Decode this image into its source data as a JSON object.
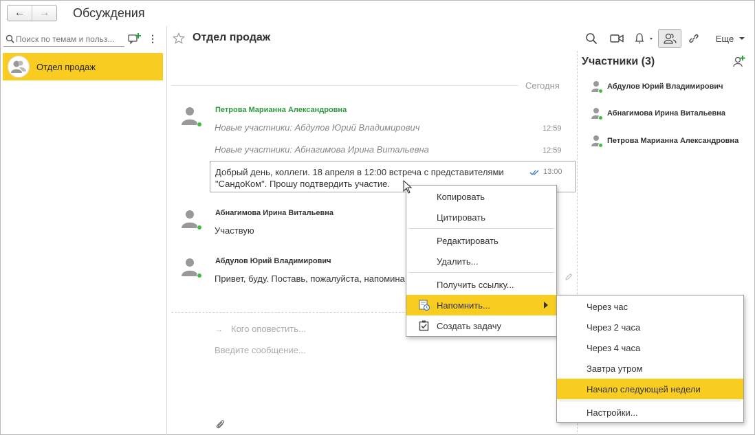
{
  "app": {
    "title": "Обсуждения"
  },
  "left": {
    "search_placeholder": "Поиск по темам и польз...",
    "conversations": [
      {
        "label": "Отдел продаж"
      }
    ]
  },
  "chat": {
    "title": "Отдел продаж",
    "more_label": "Еще",
    "today": "Сегодня",
    "messages": {
      "author1": "Петрова Марианна Александровна",
      "sys1": "Новые участники: Абдулов Юрий Владимирович",
      "sys1_time": "12:59",
      "sys2": "Новые участники: Абнагимова Ирина Витальевна",
      "sys2_time": "12:59",
      "main_text_line1": "Добрый день, коллеги. 18 апреля в 12:00 встреча с представителями",
      "main_text_line2": "\"СандоКом\". Прошу подтвердить участие.",
      "main_time": "13:00",
      "author2": "Абнагимова Ирина Витальевна",
      "text2": "Участвую",
      "author3": "Абдулов Юрий Владимирович",
      "text3": "Привет, буду. Поставь, пожалуйста, напомина"
    },
    "notify_placeholder": "Кого оповестить...",
    "compose_placeholder": "Введите сообщение..."
  },
  "participants": {
    "title": "Участники (3)",
    "items": [
      {
        "name": "Абдулов Юрий Владимирович"
      },
      {
        "name": "Абнагимова Ирина Витальевна"
      },
      {
        "name": "Петрова Марианна Александровна"
      }
    ]
  },
  "context_menu": {
    "copy": "Копировать",
    "quote": "Цитировать",
    "edit": "Редактировать",
    "delete": "Удалить...",
    "get_link": "Получить ссылку...",
    "remind": "Напомнить...",
    "create_task": "Создать задачу"
  },
  "submenu": {
    "items": [
      {
        "label": "Через час"
      },
      {
        "label": "Через 2 часа"
      },
      {
        "label": "Через 4 часа"
      },
      {
        "label": "Завтра утром"
      },
      {
        "label": "Начало следующей недели"
      },
      {
        "label": "Настройки..."
      }
    ]
  },
  "colors": {
    "accent": "#f9cc22",
    "online": "#3fbe3f",
    "author_green": "#2e9a3e"
  }
}
